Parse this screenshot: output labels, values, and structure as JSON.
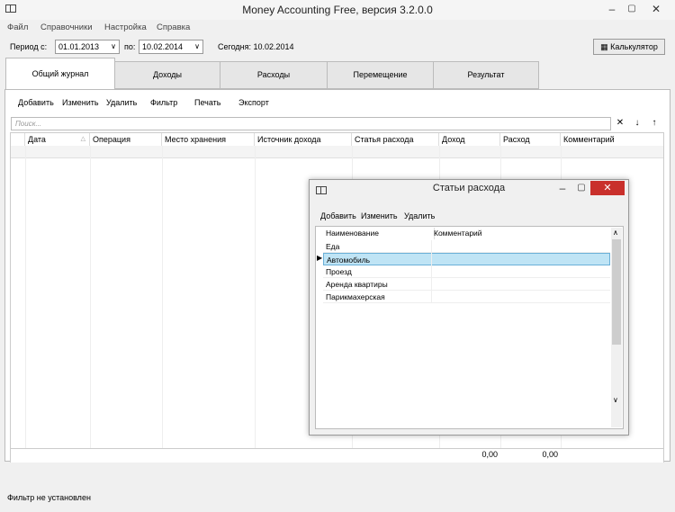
{
  "window": {
    "title": "Money Accounting Free,  версия 3.2.0.0"
  },
  "menu": [
    "Файл",
    "Справочники",
    "Настройка",
    "Справка"
  ],
  "period": {
    "from_label": "Период с:",
    "from_value": "01.01.2013",
    "to_label": "по:",
    "to_value": "10.02.2014",
    "today": "Сегодня: 10.02.2014"
  },
  "calculator_label": "Калькулятор",
  "tabs": [
    "Общий журнал",
    "Доходы",
    "Расходы",
    "Перемещение",
    "Результат"
  ],
  "toolbar": [
    "Добавить",
    "Изменить",
    "Удалить",
    "Фильтр",
    "Печать",
    "Экспорт"
  ],
  "search": {
    "placeholder": "Поиск..."
  },
  "search_buttons": [
    "✕",
    "↓",
    "↑"
  ],
  "columns": [
    "Дата",
    "Операция",
    "Место хранения",
    "Источник дохода",
    "Статья расхода",
    "Доход",
    "Расход",
    "Комментарий"
  ],
  "totals": {
    "income": "0,00",
    "expense": "0,00"
  },
  "status": "Фильтр не установлен",
  "dialog": {
    "title": "Статьи расхода",
    "toolbar": [
      "Добавить",
      "Изменить",
      "Удалить"
    ],
    "columns": [
      "Наименование",
      "Комментарий"
    ],
    "rows": [
      "Еда",
      "Автомобиль",
      "Проезд",
      "Аренда квартиры",
      "Парикмахерская"
    ]
  }
}
